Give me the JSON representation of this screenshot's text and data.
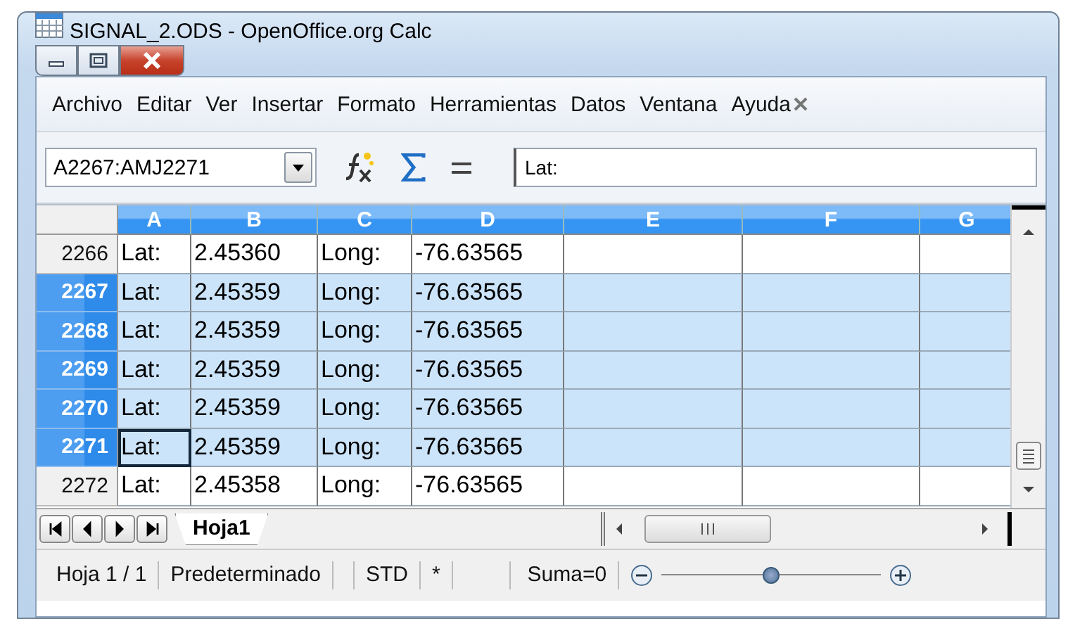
{
  "window": {
    "title": "SIGNAL_2.ODS - OpenOffice.org Calc"
  },
  "menu": [
    "Archivo",
    "Editar",
    "Ver",
    "Insertar",
    "Formato",
    "Herramientas",
    "Datos",
    "Ventana",
    "Ayuda"
  ],
  "formula_bar": {
    "name_box": "A2267:AMJ2271",
    "content": "Lat:"
  },
  "grid": {
    "columns": [
      {
        "label": "A",
        "selected": true
      },
      {
        "label": "B",
        "selected": true
      },
      {
        "label": "C",
        "selected": true
      },
      {
        "label": "D",
        "selected": true
      },
      {
        "label": "E",
        "selected": true
      },
      {
        "label": "F",
        "selected": true
      },
      {
        "label": "G",
        "selected": true
      }
    ],
    "rows": [
      {
        "number": "2266",
        "selected": false,
        "cursor": false,
        "cells": [
          "Lat:",
          "2.45360",
          "Long:",
          "-76.63565"
        ]
      },
      {
        "number": "2267",
        "selected": true,
        "cursor": false,
        "cells": [
          "Lat:",
          "2.45359",
          "Long:",
          "-76.63565"
        ]
      },
      {
        "number": "2268",
        "selected": true,
        "cursor": false,
        "cells": [
          "Lat:",
          "2.45359",
          "Long:",
          "-76.63565"
        ]
      },
      {
        "number": "2269",
        "selected": true,
        "cursor": false,
        "cells": [
          "Lat:",
          "2.45359",
          "Long:",
          "-76.63565"
        ]
      },
      {
        "number": "2270",
        "selected": true,
        "cursor": false,
        "cells": [
          "Lat:",
          "2.45359",
          "Long:",
          "-76.63565"
        ]
      },
      {
        "number": "2271",
        "selected": true,
        "cursor": true,
        "cells": [
          "Lat:",
          "2.45359",
          "Long:",
          "-76.63565"
        ]
      },
      {
        "number": "2272",
        "selected": false,
        "cursor": false,
        "cells": [
          "Lat:",
          "2.45358",
          "Long:",
          "-76.63565"
        ]
      }
    ]
  },
  "sheet_tabs": [
    {
      "label": "Hoja1",
      "selected": true
    }
  ],
  "status_bar": {
    "sheet": "Hoja 1 / 1",
    "page_style": "Predeterminado",
    "mode": "STD",
    "modified": "*",
    "sum": "Suma=0",
    "zoom": {
      "level": 0.5
    }
  }
}
